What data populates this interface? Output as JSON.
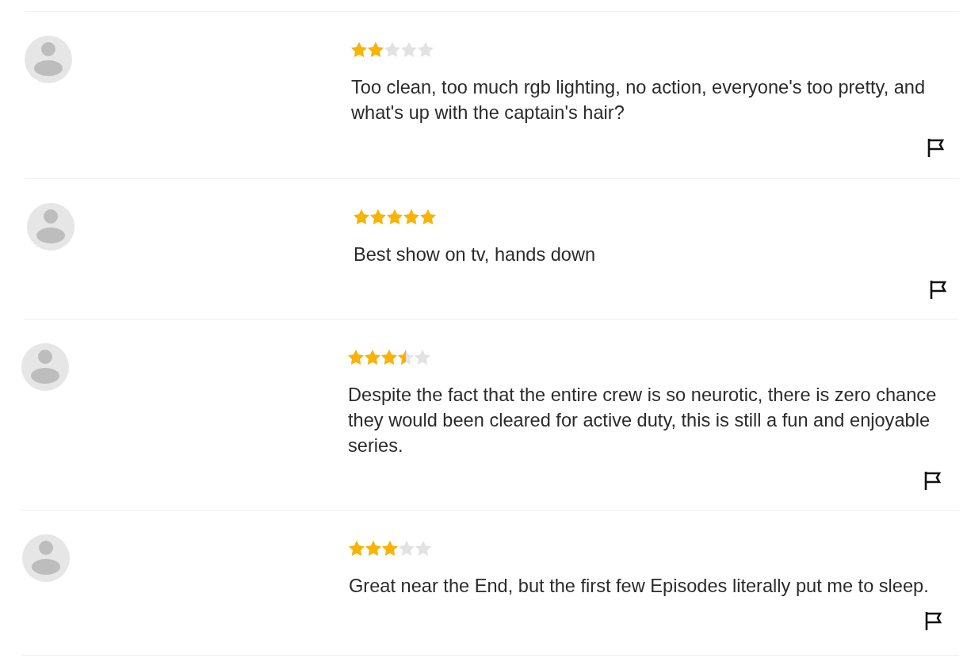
{
  "reviews": [
    {
      "stars": 2,
      "text": "Too clean, too much rgb lighting, no action, everyone's too pretty, and what's up with the captain's hair?"
    },
    {
      "stars": 5,
      "text": "Best show on tv, hands down"
    },
    {
      "stars": 3.5,
      "text": "Despite the fact that the entire crew is so neurotic, there is zero chance they would been cleared for active duty, this is still a fun and enjoyable series."
    },
    {
      "stars": 3,
      "text": "Great near the End, but the first few Episodes literally put me to sleep."
    }
  ]
}
